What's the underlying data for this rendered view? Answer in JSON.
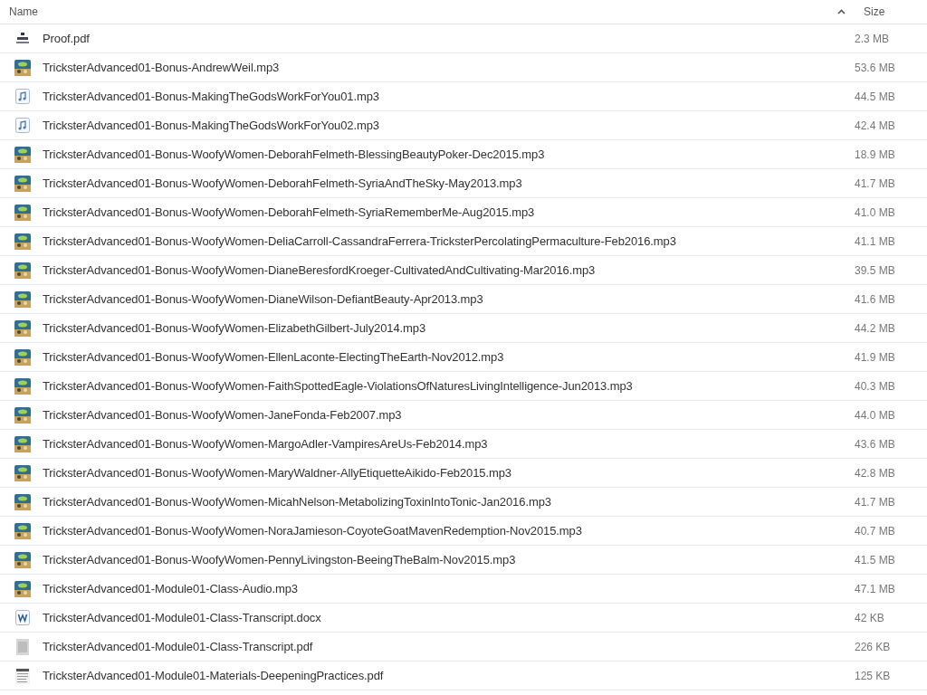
{
  "columns": [
    {
      "label": "Name",
      "sorted": true
    },
    {
      "label": "Size",
      "sorted": false
    }
  ],
  "rows": [
    {
      "kind": "cover",
      "name": "Proof.pdf",
      "size": "2.3 MB"
    },
    {
      "kind": "album",
      "name": "TricksterAdvanced01-Bonus-AndrewWeil.mp3",
      "size": "53.6 MB"
    },
    {
      "kind": "audio",
      "name": "TricksterAdvanced01-Bonus-MakingTheGodsWorkForYou01.mp3",
      "size": "44.5 MB"
    },
    {
      "kind": "audio",
      "name": "TricksterAdvanced01-Bonus-MakingTheGodsWorkForYou02.mp3",
      "size": "42.4 MB"
    },
    {
      "kind": "album",
      "name": "TricksterAdvanced01-Bonus-WoofyWomen-DeborahFelmeth-BlessingBeautyPoker-Dec2015.mp3",
      "size": "18.9 MB"
    },
    {
      "kind": "album",
      "name": "TricksterAdvanced01-Bonus-WoofyWomen-DeborahFelmeth-SyriaAndTheSky-May2013.mp3",
      "size": "41.7 MB"
    },
    {
      "kind": "album",
      "name": "TricksterAdvanced01-Bonus-WoofyWomen-DeborahFelmeth-SyriaRememberMe-Aug2015.mp3",
      "size": "41.0 MB"
    },
    {
      "kind": "album",
      "name": "TricksterAdvanced01-Bonus-WoofyWomen-DeliaCarroll-CassandraFerrera-TricksterPercolatingPermaculture-Feb2016.mp3",
      "size": "41.1 MB"
    },
    {
      "kind": "album",
      "name": "TricksterAdvanced01-Bonus-WoofyWomen-DianeBeresfordKroeger-CultivatedAndCultivating-Mar2016.mp3",
      "size": "39.5 MB"
    },
    {
      "kind": "album",
      "name": "TricksterAdvanced01-Bonus-WoofyWomen-DianeWilson-DefiantBeauty-Apr2013.mp3",
      "size": "41.6 MB"
    },
    {
      "kind": "album",
      "name": "TricksterAdvanced01-Bonus-WoofyWomen-ElizabethGilbert-July2014.mp3",
      "size": "44.2 MB"
    },
    {
      "kind": "album",
      "name": "TricksterAdvanced01-Bonus-WoofyWomen-EllenLaconte-ElectingTheEarth-Nov2012.mp3",
      "size": "41.9 MB"
    },
    {
      "kind": "album",
      "name": "TricksterAdvanced01-Bonus-WoofyWomen-FaithSpottedEagle-ViolationsOfNaturesLivingIntelligence-Jun2013.mp3",
      "size": "40.3 MB"
    },
    {
      "kind": "album",
      "name": "TricksterAdvanced01-Bonus-WoofyWomen-JaneFonda-Feb2007.mp3",
      "size": "44.0 MB"
    },
    {
      "kind": "album",
      "name": "TricksterAdvanced01-Bonus-WoofyWomen-MargoAdler-VampiresAreUs-Feb2014.mp3",
      "size": "43.6 MB"
    },
    {
      "kind": "album",
      "name": "TricksterAdvanced01-Bonus-WoofyWomen-MaryWaldner-AllyEtiquetteAikido-Feb2015.mp3",
      "size": "42.8 MB"
    },
    {
      "kind": "album",
      "name": "TricksterAdvanced01-Bonus-WoofyWomen-MicahNelson-MetabolizingToxinIntoTonic-Jan2016.mp3",
      "size": "41.7 MB"
    },
    {
      "kind": "album",
      "name": "TricksterAdvanced01-Bonus-WoofyWomen-NoraJamieson-CoyoteGoatMavenRedemption-Nov2015.mp3",
      "size": "40.7 MB"
    },
    {
      "kind": "album",
      "name": "TricksterAdvanced01-Bonus-WoofyWomen-PennyLivingston-BeeingTheBalm-Nov2015.mp3",
      "size": "41.5 MB"
    },
    {
      "kind": "album",
      "name": "TricksterAdvanced01-Module01-Class-Audio.mp3",
      "size": "47.1 MB"
    },
    {
      "kind": "word",
      "name": "TricksterAdvanced01-Module01-Class-Transcript.docx",
      "size": "42 KB"
    },
    {
      "kind": "scan",
      "name": "TricksterAdvanced01-Module01-Class-Transcript.pdf",
      "size": "226 KB"
    },
    {
      "kind": "page",
      "name": "TricksterAdvanced01-Module01-Materials-DeepeningPractices.pdf",
      "size": "125 KB"
    }
  ]
}
